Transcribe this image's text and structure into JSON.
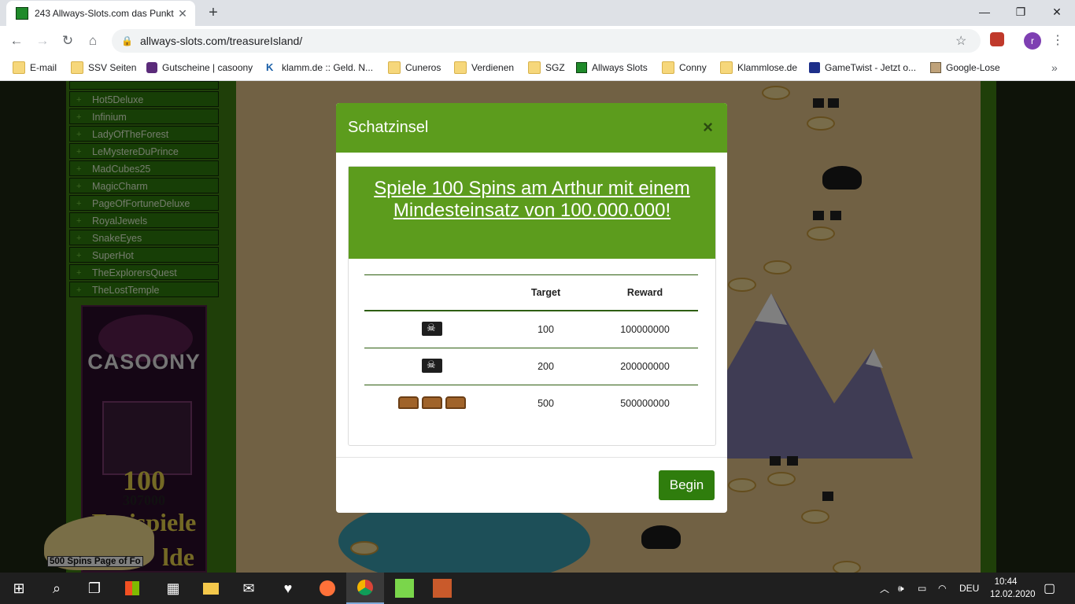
{
  "browser": {
    "tab_title": "243 Allways-Slots.com das Punkt",
    "url": "allways-slots.com/treasureIsland/",
    "profile_initial": "r"
  },
  "bookmarks": [
    {
      "label": "E-mail",
      "icon": "folder-icon"
    },
    {
      "label": "SSV Seiten",
      "icon": "folder-icon"
    },
    {
      "label": "Gutscheine | casoony",
      "icon": "casoony-icon"
    },
    {
      "label": "klamm.de :: Geld. N...",
      "icon": "klamm-icon"
    },
    {
      "label": "Cuneros",
      "icon": "folder-icon"
    },
    {
      "label": "Verdienen",
      "icon": "folder-icon"
    },
    {
      "label": "SGZ",
      "icon": "folder-icon"
    },
    {
      "label": "Allways Slots",
      "icon": "allways-icon"
    },
    {
      "label": "Conny",
      "icon": "folder-icon"
    },
    {
      "label": "Klammlose.de",
      "icon": "folder-icon"
    },
    {
      "label": "GameTwist - Jetzt o...",
      "icon": "gametwist-icon"
    },
    {
      "label": "Google-Lose",
      "icon": "google-lose-icon"
    }
  ],
  "sidebar": {
    "items": [
      "Hot5Deluxe",
      "Infinium",
      "LadyOfTheForest",
      "LeMystereDuPrince",
      "MadCubes25",
      "MagicCharm",
      "PageOfFortuneDeluxe",
      "RoyalJewels",
      "SnakeEyes",
      "SuperHot",
      "TheExplorersQuest",
      "TheLostTemple"
    ]
  },
  "ad": {
    "logo": "CASOONY",
    "big": "100",
    "num": "307000",
    "frei": "Freispiele",
    "gelde": "lde"
  },
  "promo": {
    "label": "500 Spins Page of Fo"
  },
  "modal": {
    "title": "Schatzinsel",
    "close": "×",
    "task": "Spiele 100 Spins am Arthur mit einem Mindesteinsatz von 100.000.000!",
    "columns": [
      "",
      "Target",
      "Reward"
    ],
    "rows": [
      {
        "icon": "pirate-flag-icon",
        "target": "100",
        "reward": "100000000"
      },
      {
        "icon": "pirate-flag-icon",
        "target": "200",
        "reward": "200000000"
      },
      {
        "icon": "treasure-chests-icon",
        "target": "500",
        "reward": "500000000"
      }
    ],
    "begin_label": "Begin"
  },
  "taskbar": {
    "lang": "DEU",
    "time": "10:44",
    "date": "12.02.2020"
  }
}
